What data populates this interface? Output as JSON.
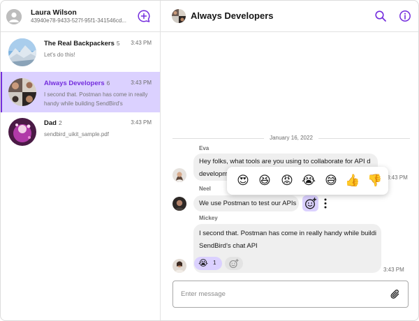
{
  "profile": {
    "name": "Laura Wilson",
    "user_id": "43940e78-9433-527f-95f1-341546cd..."
  },
  "channels": [
    {
      "title": "The Real Backpackers",
      "members": "5",
      "time": "3:43 PM",
      "last_message": "Let's do this!",
      "active": false
    },
    {
      "title": "Always Developers",
      "members": "6",
      "time": "3:43 PM",
      "last_message": "I second that. Postman has come in really handy while building SendBird's",
      "active": true
    },
    {
      "title": "Dad",
      "members": "2",
      "time": "3:43 PM",
      "last_message": "sendbird_uikit_sample.pdf",
      "active": false
    }
  ],
  "header": {
    "title": "Always Developers"
  },
  "date_separator": "January 16, 2022",
  "messages": [
    {
      "sender": "Eva",
      "text_line1": "Hey folks, what tools are you using to collaborate for API d",
      "text_line2": "developmen",
      "time": "3:43 PM"
    },
    {
      "sender": "Neel",
      "text": "We use Postman to test our APIs"
    },
    {
      "sender": "Mickey",
      "text_line1": "I second that. Postman has come in really handy while buildi",
      "text_line2": "SendBird's chat API",
      "time": "3:43 PM",
      "reaction": {
        "emoji": "😭",
        "count": "1"
      }
    }
  ],
  "reaction_picker": [
    {
      "name": "heart-eyes",
      "emoji": "😍"
    },
    {
      "name": "laughing",
      "emoji": "😆"
    },
    {
      "name": "angry",
      "emoji": "😡"
    },
    {
      "name": "crying",
      "emoji": "😭"
    },
    {
      "name": "sweat-smile",
      "emoji": "😅"
    },
    {
      "name": "thumbs-up",
      "emoji": "👍"
    },
    {
      "name": "thumbs-down",
      "emoji": "👎"
    }
  ],
  "input": {
    "placeholder": "Enter message"
  },
  "colors": {
    "accent": "#742ddd",
    "accent_light": "#dbd1ff",
    "bubble": "#efefef"
  },
  "icons": [
    "new-channel-icon",
    "search-icon",
    "info-icon",
    "add-reaction-icon",
    "more-icon",
    "attach-icon"
  ]
}
